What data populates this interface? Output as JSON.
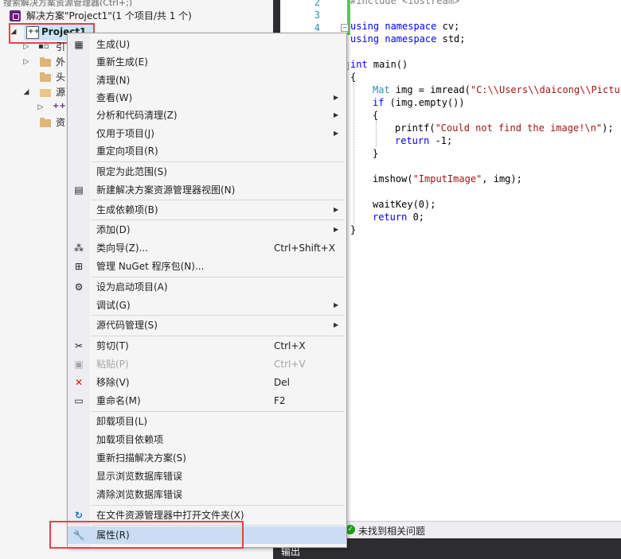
{
  "solution_explorer": {
    "search_hint": "搜索解决方案资源管理器(Ctrl+;)",
    "solution_label": "解决方案\"Project1\"(1 个项目/共 1 个)",
    "project_label": "Project1",
    "tree_items": [
      {
        "label": "引",
        "icon": "references-icon"
      },
      {
        "label": "外",
        "icon": "external-deps-icon"
      },
      {
        "label": "头",
        "icon": "folder-icon"
      },
      {
        "label": "源",
        "icon": "folder-open-icon"
      },
      {
        "label": "",
        "icon": "cpp-file-icon"
      },
      {
        "label": "资",
        "icon": "folder-icon"
      }
    ]
  },
  "editor": {
    "line_numbers": [
      "2",
      "3",
      "4"
    ],
    "lines": {
      "include": "#include <iostream>",
      "using_cv_kw": "using namespace",
      "using_cv_name": " cv;",
      "using_std_kw": "using namespace",
      "using_std_name": " std;",
      "main_kw": "int",
      "main_rest": " main()",
      "open_brace": "{",
      "mat_type": "Mat",
      "mat_rest": " img = imread(",
      "mat_str": "\"C:\\\\Users\\\\daicong\\\\Picture",
      "if_kw": "if",
      "if_rest": " (img.empty())",
      "if_open": "{",
      "printf_fn": "printf(",
      "printf_str": "\"Could not find the image!\\n\"",
      "printf_end": ");",
      "return_kw": "return",
      "return_rest": " -1;",
      "if_close": "}",
      "imshow_fn": "imshow(",
      "imshow_str": "\"ImputImage\"",
      "imshow_end": ", img);",
      "waitkey": "waitKey(0);",
      "return0_kw": "return",
      "return0_rest": " 0;",
      "close_brace": "}"
    }
  },
  "status_bar": {
    "text": "未找到相关问题"
  },
  "output_panel": {
    "tab_label": "输出"
  },
  "context_menu": {
    "items": [
      {
        "label": "生成(U)",
        "icon": "build-icon"
      },
      {
        "label": "重新生成(E)"
      },
      {
        "label": "清理(N)"
      },
      {
        "label": "查看(W)",
        "submenu": true
      },
      {
        "label": "分析和代码清理(Z)",
        "submenu": true
      },
      {
        "label": "仅用于项目(J)",
        "submenu": true
      },
      {
        "label": "重定向项目(R)"
      },
      {
        "label": "限定为此范围(S)"
      },
      {
        "label": "新建解决方案资源管理器视图(N)",
        "icon": "new-view-icon"
      },
      {
        "label": "生成依赖项(B)",
        "submenu": true
      },
      {
        "label": "添加(D)",
        "submenu": true
      },
      {
        "label": "类向导(Z)...",
        "shortcut": "Ctrl+Shift+X",
        "icon": "class-wizard-icon"
      },
      {
        "label": "管理 NuGet 程序包(N)...",
        "icon": "nuget-icon"
      },
      {
        "label": "设为启动项目(A)",
        "icon": "gear-icon"
      },
      {
        "label": "调试(G)",
        "submenu": true
      },
      {
        "label": "源代码管理(S)",
        "submenu": true
      },
      {
        "label": "剪切(T)",
        "shortcut": "Ctrl+X",
        "icon": "scissors-icon"
      },
      {
        "label": "粘贴(P)",
        "shortcut": "Ctrl+V",
        "icon": "paste-icon",
        "disabled": true
      },
      {
        "label": "移除(V)",
        "shortcut": "Del",
        "icon": "remove-icon"
      },
      {
        "label": "重命名(M)",
        "shortcut": "F2",
        "icon": "rename-icon"
      },
      {
        "label": "卸载项目(L)"
      },
      {
        "label": "加载项目依赖项"
      },
      {
        "label": "重新扫描解决方案(S)"
      },
      {
        "label": "显示浏览数据库错误"
      },
      {
        "label": "清除浏览数据库错误"
      },
      {
        "label": "在文件资源管理器中打开文件夹(X)",
        "icon": "open-folder-icon"
      },
      {
        "label": "属性(R)",
        "icon": "wrench-icon",
        "highlighted": true
      }
    ]
  },
  "colors": {
    "highlight": "#c9def5",
    "annotation_red": "#e8414a",
    "keyword": "#0000ff",
    "string": "#a31515",
    "type": "#2b91af"
  }
}
